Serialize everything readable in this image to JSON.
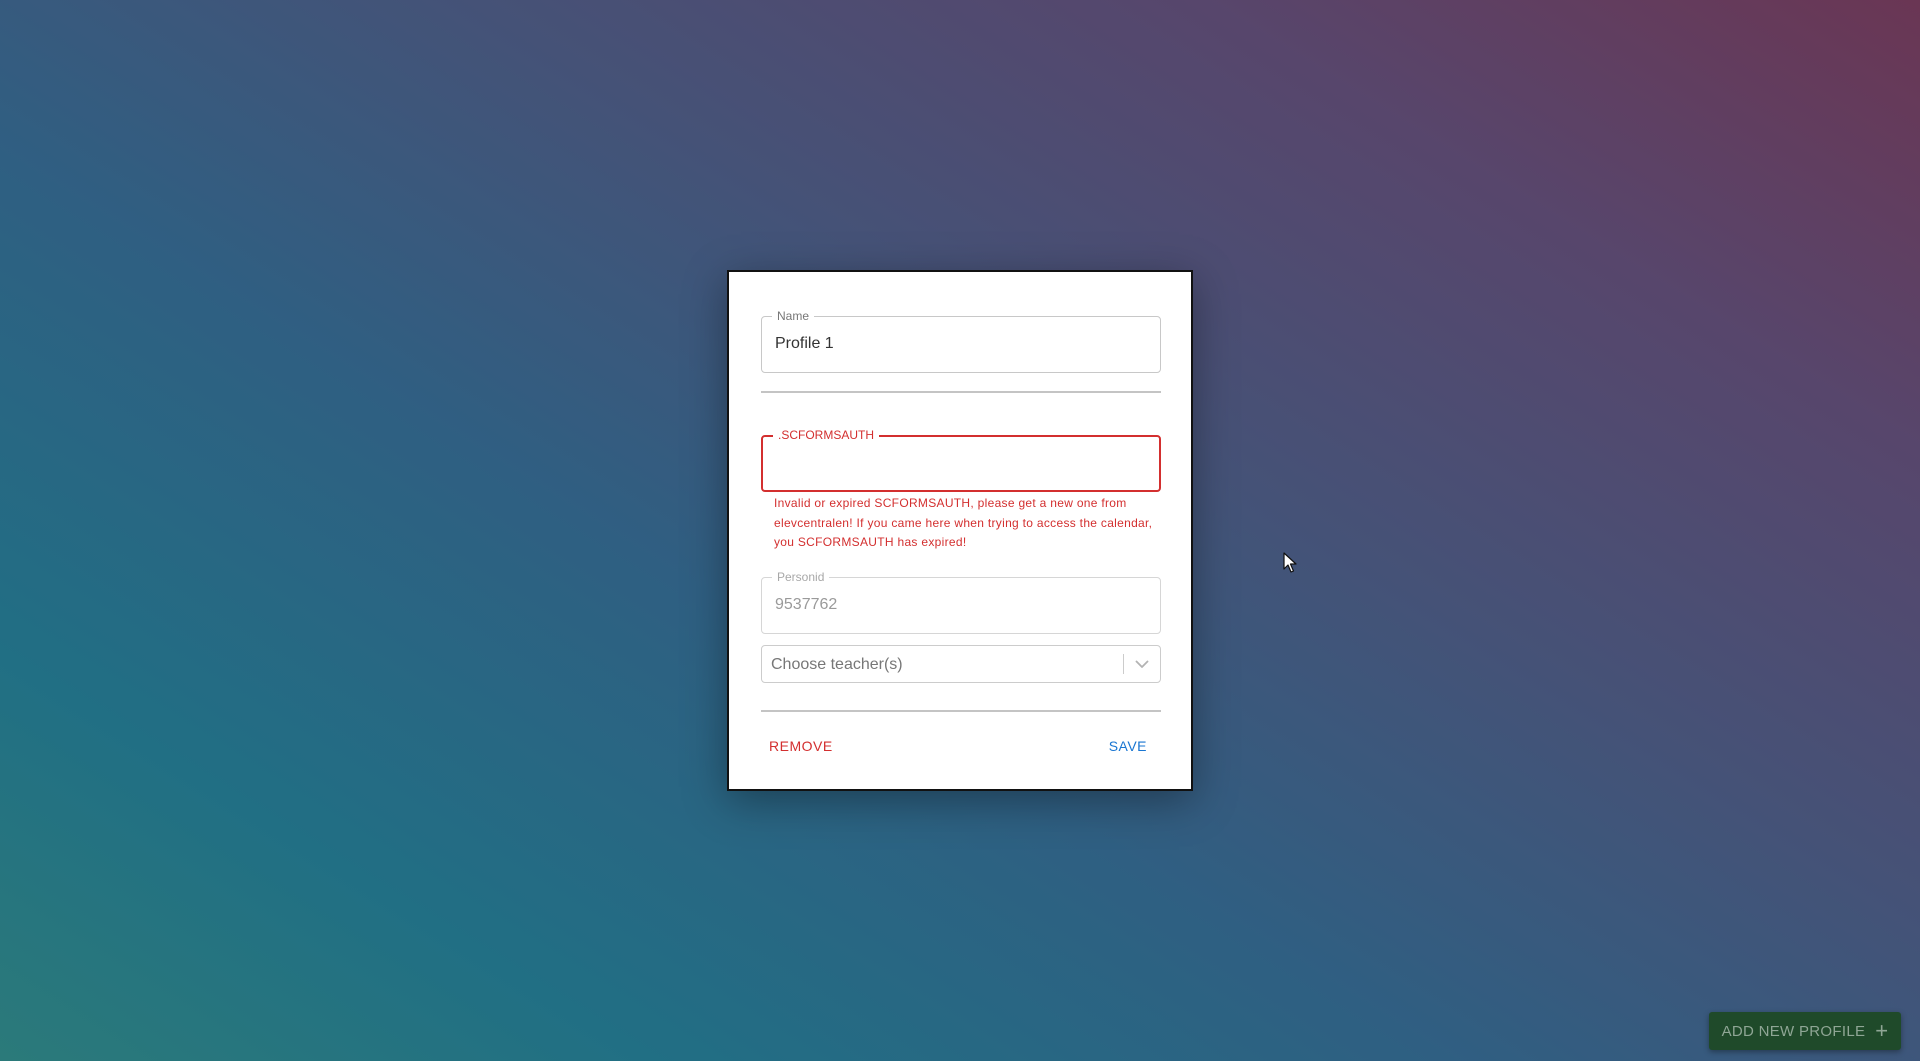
{
  "modal": {
    "name_field": {
      "label": "Name",
      "value": "Profile 1"
    },
    "auth_field": {
      "label": ".SCFORMSAUTH",
      "value": ""
    },
    "auth_error": "Invalid or expired SCFORMSAUTH, please get a new one from elevcentralen! If you came here when trying to access the calendar, you SCFORMSAUTH has expired!",
    "personid_field": {
      "label": "Personid",
      "value": "9537762"
    },
    "teacher_select": {
      "placeholder": "Choose teacher(s)",
      "icon": "chevron-down-icon"
    },
    "remove_label": "REMOVE",
    "save_label": "SAVE"
  },
  "add_profile": {
    "label": "ADD NEW PROFILE",
    "icon": "plus-icon"
  },
  "colors": {
    "error": "#d32f2f",
    "primary": "#1976d2",
    "add_button_bg": "#1f4a2a"
  }
}
